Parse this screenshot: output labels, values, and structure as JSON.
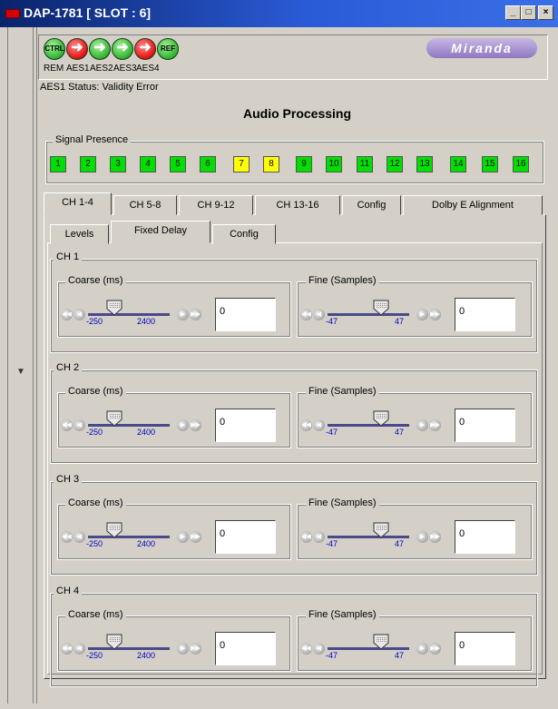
{
  "window": {
    "title": "DAP-1781 [ SLOT : 6]",
    "min_label": "_",
    "max_label": "□",
    "close_label": "×"
  },
  "header": {
    "leds": [
      {
        "icon": "ctrl-led",
        "text": "CTRL",
        "color": "green"
      },
      {
        "icon": "aes1-arrow-led",
        "text": "➜",
        "color": "red"
      },
      {
        "icon": "aes2-arrow-led",
        "text": "➜",
        "color": "green"
      },
      {
        "icon": "aes3-arrow-led",
        "text": "➜",
        "color": "green"
      },
      {
        "icon": "aes4-arrow-led",
        "text": "➜",
        "color": "red"
      },
      {
        "icon": "ref-led",
        "text": "REF",
        "color": "green"
      }
    ],
    "led_labels": [
      "REM",
      "AES1",
      "AES2",
      "AES3",
      "AES4"
    ],
    "logo": "Miranda"
  },
  "status": "AES1 Status: Validity Error",
  "heading": "Audio Processing",
  "signal_presence": {
    "label": "Signal Presence",
    "channels": [
      {
        "n": "1",
        "state": "green"
      },
      {
        "n": "2",
        "state": "green"
      },
      {
        "n": "3",
        "state": "green"
      },
      {
        "n": "4",
        "state": "green"
      },
      {
        "n": "5",
        "state": "green"
      },
      {
        "n": "6",
        "state": "green"
      },
      {
        "n": "7",
        "state": "yellow"
      },
      {
        "n": "8",
        "state": "yellow"
      },
      {
        "n": "9",
        "state": "green"
      },
      {
        "n": "10",
        "state": "green"
      },
      {
        "n": "11",
        "state": "green"
      },
      {
        "n": "12",
        "state": "green"
      },
      {
        "n": "13",
        "state": "green"
      },
      {
        "n": "14",
        "state": "green"
      },
      {
        "n": "15",
        "state": "green"
      },
      {
        "n": "16",
        "state": "green"
      }
    ]
  },
  "main_tabs": [
    "CH 1-4",
    "CH 5-8",
    "CH 9-12",
    "CH 13-16",
    "Config",
    "Dolby E Alignment"
  ],
  "sub_tabs": [
    "Levels",
    "Fixed Delay",
    "Config"
  ],
  "channels": [
    {
      "label": "CH 1",
      "coarse_label": "Coarse (ms)",
      "coarse_min": "-250",
      "coarse_max": "2400",
      "coarse_value": "0",
      "fine_label": "Fine (Samples)",
      "fine_min": "-47",
      "fine_max": "47",
      "fine_value": "0"
    },
    {
      "label": "CH 2",
      "coarse_label": "Coarse (ms)",
      "coarse_min": "-250",
      "coarse_max": "2400",
      "coarse_value": "0",
      "fine_label": "Fine (Samples)",
      "fine_min": "-47",
      "fine_max": "47",
      "fine_value": "0"
    },
    {
      "label": "CH 3",
      "coarse_label": "Coarse (ms)",
      "coarse_min": "-250",
      "coarse_max": "2400",
      "coarse_value": "0",
      "fine_label": "Fine (Samples)",
      "fine_min": "-47",
      "fine_max": "47",
      "fine_value": "0"
    },
    {
      "label": "CH 4",
      "coarse_label": "Coarse (ms)",
      "coarse_min": "-250",
      "coarse_max": "2400",
      "coarse_value": "0",
      "fine_label": "Fine (Samples)",
      "fine_min": "-47",
      "fine_max": "47",
      "fine_value": "0"
    }
  ],
  "colors": {
    "active_green": "#00e000",
    "warning_yellow": "#ffff00",
    "tick_blue": "#0000c0",
    "title_blue": "#0a246a"
  }
}
